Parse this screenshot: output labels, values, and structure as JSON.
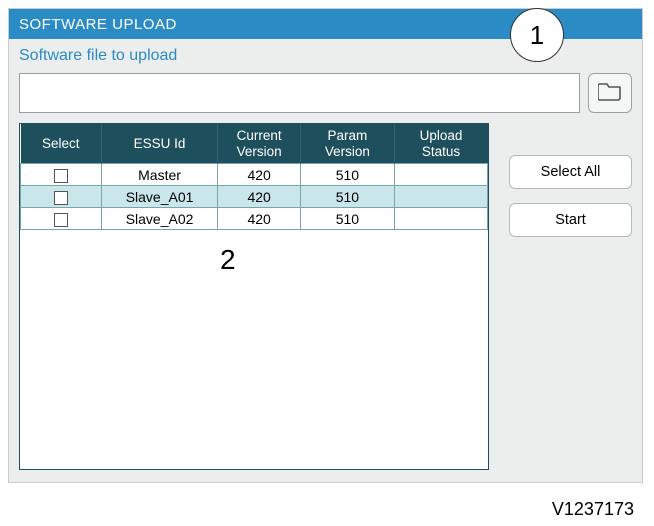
{
  "title": "SOFTWARE UPLOAD",
  "subtitle": "Software file to upload",
  "file_path": "",
  "file_placeholder": "",
  "columns": {
    "select": "Select",
    "essu_id": "ESSU Id",
    "current_version_a": "Current",
    "current_version_b": "Version",
    "param_version_a": "Param",
    "param_version_b": "Version",
    "upload_status_a": "Upload",
    "upload_status_b": "Status"
  },
  "rows": [
    {
      "selected": false,
      "essu_id": "Master",
      "current_version": "420",
      "param_version": "510",
      "upload_status": ""
    },
    {
      "selected": false,
      "essu_id": "Slave_A01",
      "current_version": "420",
      "param_version": "510",
      "upload_status": ""
    },
    {
      "selected": false,
      "essu_id": "Slave_A02",
      "current_version": "420",
      "param_version": "510",
      "upload_status": ""
    }
  ],
  "buttons": {
    "select_all": "Select All",
    "start": "Start"
  },
  "callouts": {
    "one": "1",
    "two": "2"
  },
  "figure_id": "V1237173"
}
